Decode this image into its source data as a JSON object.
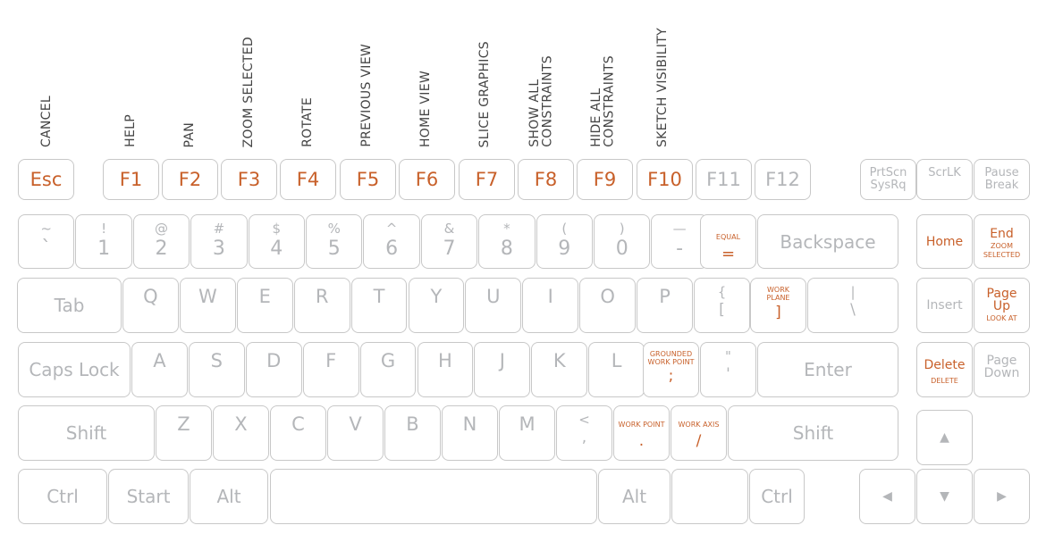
{
  "accent_color": "#c8602a",
  "fkey_labels": {
    "esc": "CANCEL",
    "f1": "HELP",
    "f2": "PAN",
    "f3": "ZOOM SELECTED",
    "f4": "ROTATE",
    "f5": "PREVIOUS VIEW",
    "f6": "HOME VIEW",
    "f7": "SLICE GRAPHICS",
    "f8": "SHOW ALL\nCONSTRAINTS",
    "f9": "HIDE ALL\nCONSTRAINTS",
    "f10": "SKETCH VISIBILITY"
  },
  "row_f": {
    "esc": "Esc",
    "f1": "F1",
    "f2": "F2",
    "f3": "F3",
    "f4": "F4",
    "f5": "F5",
    "f6": "F6",
    "f7": "F7",
    "f8": "F8",
    "f9": "F9",
    "f10": "F10",
    "f11": "F11",
    "f12": "F12",
    "prtscn": "PrtScn\nSysRq",
    "scrlk": "ScrLK",
    "pause": "Pause\nBreak"
  },
  "row_num": [
    {
      "top": "~",
      "main": "`"
    },
    {
      "top": "!",
      "main": "1"
    },
    {
      "top": "@",
      "main": "2"
    },
    {
      "top": "#",
      "main": "3"
    },
    {
      "top": "$",
      "main": "4"
    },
    {
      "top": "%",
      "main": "5"
    },
    {
      "top": "^",
      "main": "6"
    },
    {
      "top": "&",
      "main": "7"
    },
    {
      "top": "*",
      "main": "8"
    },
    {
      "top": "(",
      "main": "9"
    },
    {
      "top": ")",
      "main": "0"
    },
    {
      "top": "—",
      "main": "-"
    }
  ],
  "equal_key": {
    "caption": "EQUAL",
    "main": "="
  },
  "backspace": "Backspace",
  "tab": "Tab",
  "row_q": [
    "Q",
    "W",
    "E",
    "R",
    "T",
    "Y",
    "U",
    "I",
    "O",
    "P"
  ],
  "bracket_open": {
    "top": "{",
    "main": "["
  },
  "bracket_close": {
    "caption": "WORK\nPLANE",
    "main": "]"
  },
  "backslash": {
    "top": "|",
    "main": "\\"
  },
  "caps_lock": "Caps Lock",
  "row_a": [
    "A",
    "S",
    "D",
    "F",
    "G",
    "H",
    "J",
    "K",
    "L"
  ],
  "semicolon": {
    "caption": "GROUNDED\nWORK POINT",
    "main": ";"
  },
  "quote": {
    "top": "\"",
    "main": "'"
  },
  "enter": "Enter",
  "shift": "Shift",
  "row_z": [
    "Z",
    "X",
    "C",
    "V",
    "B",
    "N",
    "M"
  ],
  "comma": {
    "top": "<",
    "main": ","
  },
  "period": {
    "caption": "WORK POINT",
    "main": "."
  },
  "slash": {
    "caption": "WORK AXIS",
    "main": "/"
  },
  "bottom": {
    "ctrl": "Ctrl",
    "start": "Start",
    "alt": "Alt"
  },
  "nav": {
    "home": "Home",
    "end": "End",
    "end_sub": "ZOOM\nSELECTED",
    "insert": "Insert",
    "page_up": "Page\nUp",
    "page_up_sub": "LOOK AT",
    "delete": "Delete",
    "delete_sub": "DELETE",
    "page_down": "Page\nDown"
  },
  "arrows": {
    "up": "▲",
    "left": "◀",
    "down": "▼",
    "right": "▶"
  }
}
